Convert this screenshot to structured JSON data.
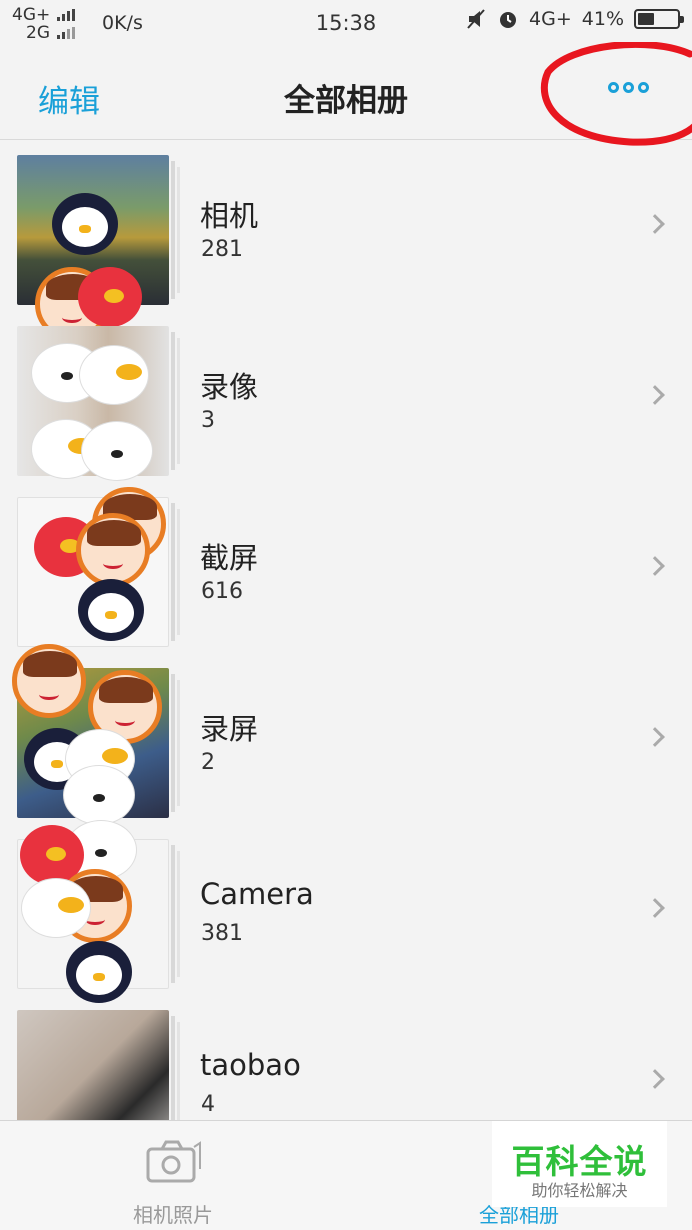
{
  "status_bar": {
    "network_top": "4G+",
    "network_bottom": "2G",
    "speed": "0K/s",
    "time": "15:38",
    "network_right": "4G+",
    "battery_percent": "41%",
    "battery_level": 0.41,
    "icons": [
      "signal-icon",
      "mute-icon",
      "alarm-icon",
      "battery-icon"
    ]
  },
  "nav": {
    "edit_label": "编辑",
    "title": "全部相册",
    "more_icon": "more-dots-icon",
    "highlight_color": "#e8161f"
  },
  "albums": [
    {
      "name": "相机",
      "count": "281"
    },
    {
      "name": "录像",
      "count": "3"
    },
    {
      "name": "截屏",
      "count": "616"
    },
    {
      "name": "录屏",
      "count": "2"
    },
    {
      "name": "Camera",
      "count": "381"
    },
    {
      "name": "taobao",
      "count": "4"
    }
  ],
  "tabs": [
    {
      "label": "相机照片",
      "icon": "camera-photo-icon",
      "active": false
    },
    {
      "label": "全部相册",
      "icon": "albums-icon",
      "active": true
    }
  ],
  "watermark": {
    "main": "百科全说",
    "sub": "助你轻松解决"
  },
  "colors": {
    "accent": "#1aa0d8",
    "background": "#f3f3f3",
    "watermark_green": "#2fbf3a"
  }
}
